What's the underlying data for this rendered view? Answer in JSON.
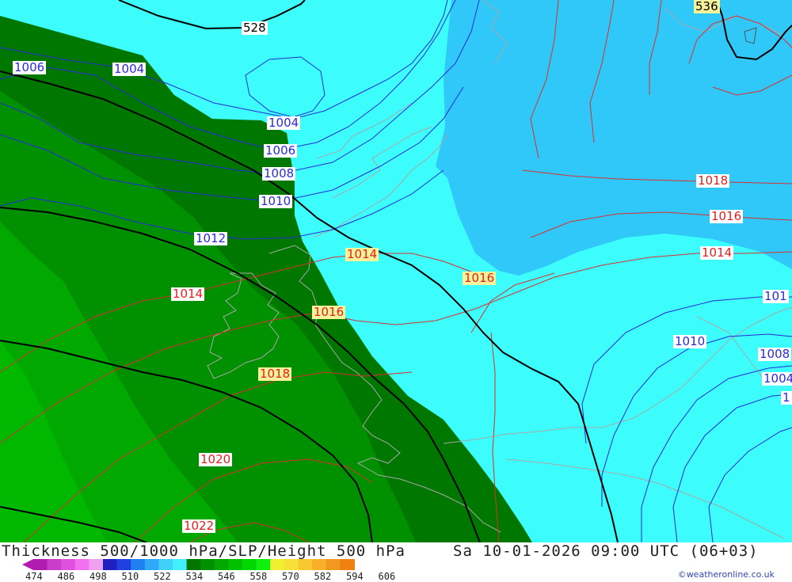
{
  "map": {
    "contour_labels": [
      {
        "text": "528",
        "color": "black"
      },
      {
        "text": "536",
        "color": "black"
      },
      {
        "text": "1006",
        "color": "blue"
      },
      {
        "text": "1004",
        "color": "blue"
      },
      {
        "text": "1004",
        "color": "blue"
      },
      {
        "text": "1006",
        "color": "blue"
      },
      {
        "text": "1008",
        "color": "blue"
      },
      {
        "text": "1010",
        "color": "blue"
      },
      {
        "text": "1012",
        "color": "blue"
      },
      {
        "text": "1014",
        "color": "red"
      },
      {
        "text": "1014",
        "color": "red"
      },
      {
        "text": "1016",
        "color": "red"
      },
      {
        "text": "1016",
        "color": "red"
      },
      {
        "text": "1018",
        "color": "red"
      },
      {
        "text": "1020",
        "color": "red"
      },
      {
        "text": "1022",
        "color": "red"
      },
      {
        "text": "1018",
        "color": "red"
      },
      {
        "text": "1016",
        "color": "red"
      },
      {
        "text": "1014",
        "color": "red"
      },
      {
        "text": "1010",
        "color": "blue"
      },
      {
        "text": "101",
        "color": "blue"
      },
      {
        "text": "1008",
        "color": "blue"
      },
      {
        "text": "1004",
        "color": "blue"
      },
      {
        "text": "1",
        "color": "blue"
      }
    ]
  },
  "footer": {
    "title": "Thickness 500/1000 hPa/SLP/Height 500 hPa",
    "datetime": "Sa 10-01-2026 09:00 UTC (06+03)",
    "credit": "©weatheronline.co.uk"
  },
  "legend": {
    "ticks": [
      "474",
      "486",
      "498",
      "510",
      "522",
      "534",
      "546",
      "558",
      "570",
      "582",
      "594",
      "606"
    ],
    "colors": [
      "#b01cb0",
      "#c83ec8",
      "#e050e0",
      "#f070f0",
      "#f0a0f0",
      "#2020c0",
      "#2040e0",
      "#2080f0",
      "#30a8f8",
      "#40d0f8",
      "#40f0ff",
      "#007800",
      "#009000",
      "#00a800",
      "#00c000",
      "#00d800",
      "#10f010",
      "#f0f030",
      "#f8e038",
      "#f8c830",
      "#f8b028",
      "#f09820",
      "#f08010"
    ]
  },
  "colors": {
    "cyan": "#3cfcfc",
    "sky": "#30c8f8",
    "dark_green": "#007800",
    "mid_green": "#009000",
    "green": "#00a800",
    "light_green": "#00b800"
  }
}
